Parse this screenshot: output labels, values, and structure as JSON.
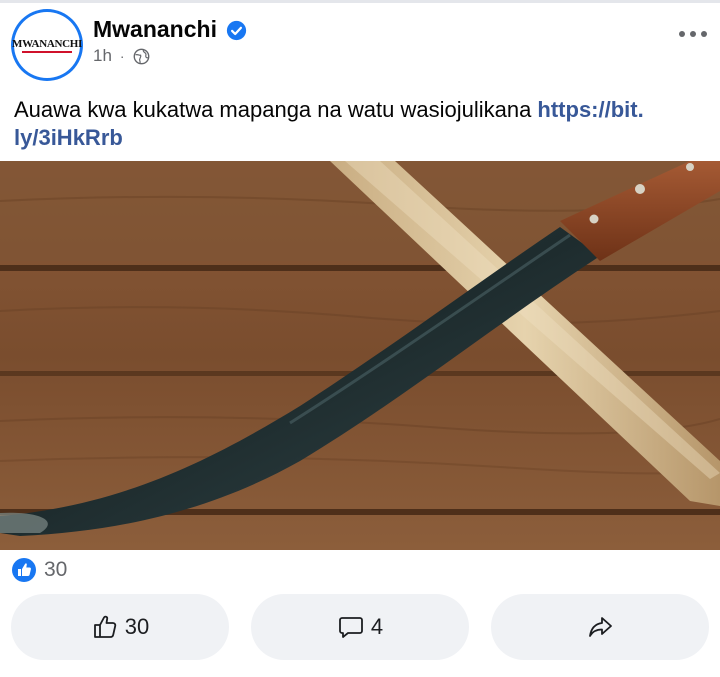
{
  "post": {
    "page_name": "Mwananchi",
    "logo_text": "MWANANCHI",
    "time": "1h",
    "separator": "·",
    "caption_text": "Auawa kwa kukatwa mapanga na watu wasiojulikana ",
    "caption_link": "https://bit.ly/3iHkRrb",
    "caption_link_line1": "https://bit.",
    "caption_link_line2": "ly/3iHkRrb"
  },
  "reactions": {
    "count": "30",
    "icon": "like-badge-icon"
  },
  "actions": {
    "like_count": "30",
    "comment_count": "4",
    "like_icon": "thumbs-up-icon",
    "comment_icon": "comment-bubble-icon",
    "share_icon": "share-arrow-icon"
  },
  "colors": {
    "accent": "#1877f2",
    "link": "#385898",
    "secondary_text": "#65676b",
    "button_bg": "#f0f2f5",
    "logo_red": "#d0112b"
  }
}
